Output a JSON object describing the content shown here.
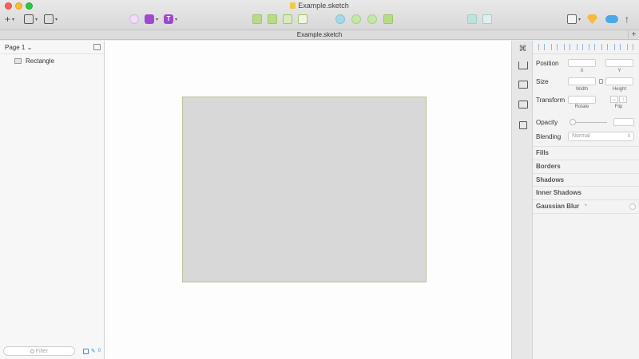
{
  "window": {
    "title": "Example.sketch",
    "tab_title": "Example.sketch",
    "tab_add": "+"
  },
  "toolbar": {
    "left_buttons": [
      "insert",
      "group",
      "create-symbol"
    ],
    "caret": "▾",
    "purple_text_label": "T"
  },
  "left_panel": {
    "page_selector": "Page 1 ⌄",
    "layers": [
      {
        "name": "Rectangle",
        "icon": "rectangle-layer-icon"
      }
    ],
    "filter_placeholder": "Filter",
    "layer_count": "0"
  },
  "inspector": {
    "position_label": "Position",
    "x_label": "X",
    "y_label": "Y",
    "size_label": "Size",
    "width_label": "Width",
    "height_label": "Height",
    "transform_label": "Transform",
    "rotate_label": "Rotate",
    "flip_label": "Flip",
    "opacity_label": "Opacity",
    "opacity_value": 0,
    "blending_label": "Blending",
    "blending_value": "Normal",
    "sections": {
      "fills": "Fills",
      "borders": "Borders",
      "shadows": "Shadows",
      "inner_shadows": "Inner Shadows",
      "gaussian_blur": "Gaussian Blur",
      "blur_updown": "⌃"
    }
  },
  "colors": {
    "accent_purple": "#a048ce",
    "canvas_bg": "#fdfdfd",
    "rectangle_fill": "#d8d8d8"
  }
}
